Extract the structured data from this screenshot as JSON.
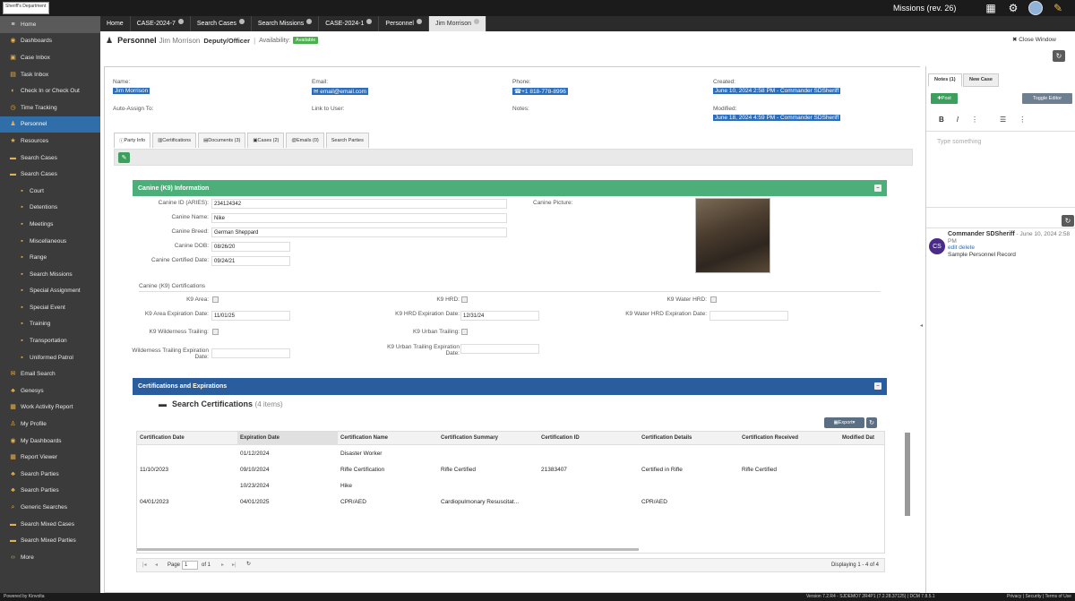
{
  "topbar": {
    "logo_text": "Sheriff's Department",
    "title": "Missions (rev. 26)",
    "icons": [
      "grid-icon",
      "gear-icon",
      "avatar",
      "wrench-icon"
    ]
  },
  "sidebar": {
    "items": [
      {
        "label": "Home",
        "icon": "home-icon"
      },
      {
        "label": "Dashboards",
        "icon": "dashboard-icon"
      },
      {
        "label": "Case Inbox",
        "icon": "inbox-icon"
      },
      {
        "label": "Task Inbox",
        "icon": "task-icon"
      },
      {
        "label": "Check In or Check Out",
        "icon": "check-icon"
      },
      {
        "label": "Time Tracking",
        "icon": "clock-icon"
      },
      {
        "label": "Personnel",
        "icon": "person-icon"
      },
      {
        "label": "Resources",
        "icon": "star-icon"
      },
      {
        "label": "Search Cases",
        "icon": "folder-icon"
      },
      {
        "label": "Search Cases",
        "icon": "folder-icon"
      },
      {
        "label": "Court",
        "icon": "doc-icon"
      },
      {
        "label": "Detentions",
        "icon": "doc-icon"
      },
      {
        "label": "Meetings",
        "icon": "doc-icon"
      },
      {
        "label": "Miscellaneous",
        "icon": "doc-icon"
      },
      {
        "label": "Range",
        "icon": "doc-icon"
      },
      {
        "label": "Search Missions",
        "icon": "doc-icon"
      },
      {
        "label": "Special Assignment",
        "icon": "doc-icon"
      },
      {
        "label": "Special Event",
        "icon": "doc-icon"
      },
      {
        "label": "Training",
        "icon": "doc-icon"
      },
      {
        "label": "Transportation",
        "icon": "doc-icon"
      },
      {
        "label": "Uniformed Patrol",
        "icon": "doc-icon"
      },
      {
        "label": "Email Search",
        "icon": "mail-icon"
      },
      {
        "label": "Genesys",
        "icon": "group-icon"
      },
      {
        "label": "Work Activity Report",
        "icon": "report-icon"
      },
      {
        "label": "My Profile",
        "icon": "profile-icon"
      },
      {
        "label": "My Dashboards",
        "icon": "dashboard-icon"
      },
      {
        "label": "Report Viewer",
        "icon": "report-icon"
      },
      {
        "label": "Search Parties",
        "icon": "group-icon"
      },
      {
        "label": "Search Parties",
        "icon": "group-icon"
      },
      {
        "label": "Generic Searches",
        "icon": "search-icon"
      },
      {
        "label": "Search Mixed Cases",
        "icon": "folder-icon"
      },
      {
        "label": "Search Mixed Parties",
        "icon": "folder-icon"
      },
      {
        "label": "More",
        "icon": "more-icon"
      }
    ]
  },
  "tabs": [
    {
      "label": "Home"
    },
    {
      "label": "CASE-2024-7"
    },
    {
      "label": "Search Cases"
    },
    {
      "label": "Search Missions"
    },
    {
      "label": "CASE-2024-1"
    },
    {
      "label": "Personnel"
    },
    {
      "label": "Jim Morrison"
    }
  ],
  "header": {
    "type": "Personnel",
    "name": "Jim Morrison",
    "role": "Deputy/Officer",
    "availability_label": "Availability:",
    "availability": "Available",
    "close": "Close Window"
  },
  "record": {
    "name_label": "Name:",
    "name": "Jim Morrison",
    "email_label": "Email:",
    "email": "email@email.com",
    "phone_label": "Phone:",
    "phone": "+1 818-778-8996",
    "created_label": "Created:",
    "created": "June 10, 2024 2:58 PM - Commander SDSheriff",
    "autoassign_label": "Auto-Assign To:",
    "link_label": "Link to User:",
    "notes_label": "Notes:",
    "modified_label": "Modified:",
    "modified": "June 18, 2024 4:59 PM - Commander SDSheriff"
  },
  "profile_tabs": [
    "Party Info",
    "Certifications",
    "Documents (3)",
    "Cases (2)",
    "Emails (0)",
    "Search Parties"
  ],
  "k9": {
    "panel_title": "Canine (K9) Information",
    "id_label": "Canine ID (ARIES):",
    "id": "234124342",
    "name_label": "Canine Name:",
    "name": "Nike",
    "breed_label": "Canine Breed:",
    "breed": "German Sheppard",
    "dob_label": "Canine DOB:",
    "dob": "08/26/20",
    "certdate_label": "Canine Certified Date:",
    "certdate": "09/24/21",
    "picture_label": "Canine Picture:"
  },
  "k9_certs": {
    "section": "Canine (K9) Certifications",
    "area_label": "K9 Area:",
    "hrd_label": "K9 HRD:",
    "water_label": "K9 Water HRD:",
    "area_exp_label": "K9 Area Expiration Date:",
    "area_exp": "11/01/25",
    "hrd_exp_label": "K9 HRD Expiration Date:",
    "hrd_exp": "12/31/24",
    "water_exp_label": "K9 Water HRD Expiration Date:",
    "wild_label": "K9 Wilderness Trailing:",
    "urban_label": "K9 Urban Trailing:",
    "wild_exp_label": "Wilderness Trailing Expiration Date:",
    "urban_exp_label": "K9 Urban Trailing Expiration Date:"
  },
  "certs": {
    "panel_title": "Certifications and Expirations",
    "title": "Search Certifications",
    "count": "(4 items)",
    "export": "Export",
    "columns": [
      "Certification Date",
      "Expiration Date",
      "Certification Name",
      "Certification Summary",
      "Certification ID",
      "Certification Details",
      "Certification Received",
      "Modified Dat"
    ],
    "rows": [
      [
        "",
        "01/12/2024",
        "Disaster Worker",
        "",
        "",
        "",
        "",
        ""
      ],
      [
        "11/10/2023",
        "09/10/2024",
        "Rifle Certification",
        "Rifle Certified",
        "21383407",
        "Certified in Rifle",
        "Rifle Certified",
        ""
      ],
      [
        "",
        "10/23/2024",
        "Hike",
        "",
        "",
        "",
        "",
        ""
      ],
      [
        "04/01/2023",
        "04/01/2025",
        "CPR/AED",
        "Cardiopulmonary Resuscitat...",
        "",
        "CPR/AED",
        "",
        ""
      ]
    ],
    "pager_page_label": "Page",
    "pager_page": "1",
    "pager_of": "of 1",
    "displaying": "Displaying 1 - 4 of 4"
  },
  "notes": {
    "tab_notes": "Notes (1)",
    "tab_new_case": "New Case",
    "post": "Post",
    "toggle": "Toggle Editor",
    "placeholder": "Type something",
    "comment_initials": "CS",
    "comment_author": "Commander SDSheriff",
    "comment_date": "- June 10, 2024 2:58 PM",
    "comment_actions": "edit delete",
    "comment_text": "Sample Personnel Record"
  },
  "footer": {
    "powered": "Powered by Kinvolta",
    "version": "Version  7.2.R4 - SJDEMO7 2R4P1 (7.2.28.37125) | DCM 7.8.5.1",
    "links": "Privacy  |  Security  |  Terms of Use"
  }
}
